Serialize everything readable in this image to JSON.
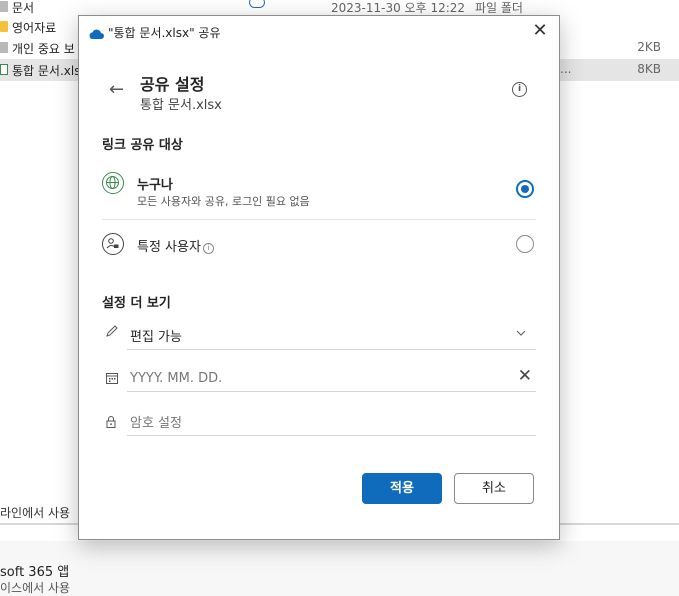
{
  "explorer": {
    "rows": [
      {
        "name": "문서",
        "date": "2023-11-30 오후 12:22",
        "type": "파일 폴더",
        "size": ""
      },
      {
        "name": "영어자료",
        "date": "",
        "type": "",
        "size": ""
      },
      {
        "name": "개인 중요 보",
        "date": "",
        "type": "",
        "size": "2KB"
      },
      {
        "name": "통합 문서.xls",
        "date": "",
        "type": "",
        "size": "8KB",
        "ellipsis": "..."
      }
    ],
    "bottom_text_1": "라인에서 사용",
    "bottom_text_2": "soft 365 앱",
    "bottom_text_3": "이스에서 사용"
  },
  "dialog": {
    "title": "\"통합 문서.xlsx\" 공유",
    "close_glyph": "✕",
    "back_glyph": "←",
    "header_title": "공유 설정",
    "header_subtitle": "통합 문서.xlsx",
    "info_glyph": "i",
    "link_section_title": "링크 공유 대상",
    "options": {
      "anyone": {
        "label": "누구나",
        "description": "모든 사용자와 공유, 로그인 필요 없음",
        "selected": true
      },
      "specific": {
        "label": "특정 사용자",
        "selected": false
      }
    },
    "more_settings_title": "설정 더 보기",
    "permission": {
      "value": "편집 가능"
    },
    "expiry": {
      "placeholder": "YYYY. MM. DD.",
      "clear_glyph": "✕"
    },
    "password": {
      "placeholder": "암호 설정"
    },
    "buttons": {
      "apply": "적용",
      "cancel": "취소"
    },
    "colors": {
      "accent": "#0f6cbd",
      "anyone_icon": "#3a8a4e"
    }
  }
}
